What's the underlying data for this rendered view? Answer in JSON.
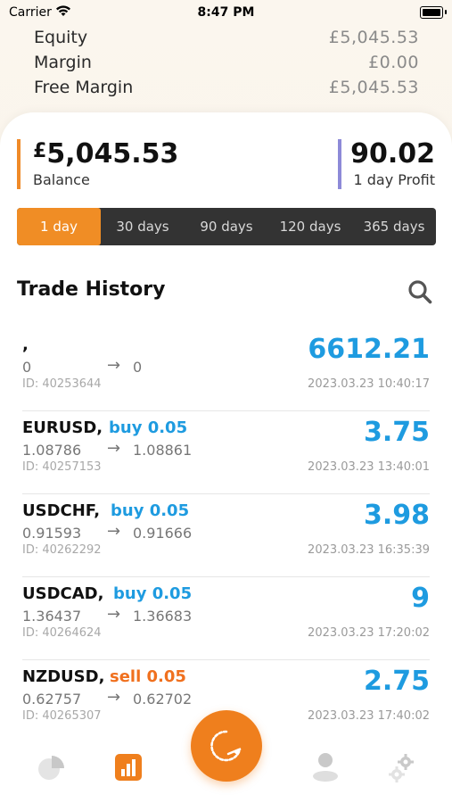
{
  "status_bar": {
    "carrier": "Carrier",
    "time": "8:47 PM"
  },
  "account": {
    "rows": [
      {
        "label": "Equity",
        "value": "£5,045.53"
      },
      {
        "label": "Margin",
        "value": "£0.00"
      },
      {
        "label": "Free Margin",
        "value": "£5,045.53"
      }
    ]
  },
  "stats": {
    "balance": {
      "currency": "£",
      "value": "5,045.53",
      "label": "Balance"
    },
    "profit": {
      "value": "90.02",
      "label": "1 day Profit"
    }
  },
  "range_tabs": [
    "1 day",
    "30 days",
    "90 days",
    "120 days",
    "365 days"
  ],
  "active_range": "1 day",
  "history": {
    "title": "Trade History",
    "trades": [
      {
        "symbol": ",",
        "side": "",
        "side_type": "",
        "open": "0",
        "arrow": "→",
        "close": "0",
        "id": "ID: 40253644",
        "profit": "6612.21",
        "time": "2023.03.23 10:40:17"
      },
      {
        "symbol": "EURUSD,",
        "side": "buy 0.05",
        "side_type": "buy",
        "open": "1.08786",
        "arrow": "→",
        "close": "1.08861",
        "id": "ID: 40257153",
        "profit": "3.75",
        "time": "2023.03.23 13:40:01"
      },
      {
        "symbol": "USDCHF,",
        "side": "buy 0.05",
        "side_type": "buy",
        "open": "0.91593",
        "arrow": "→",
        "close": "0.91666",
        "id": "ID: 40262292",
        "profit": "3.98",
        "time": "2023.03.23 16:35:39"
      },
      {
        "symbol": "USDCAD,",
        "side": "buy 0.05",
        "side_type": "buy",
        "open": "1.36437",
        "arrow": "→",
        "close": "1.36683",
        "id": "ID: 40264624",
        "profit": "9",
        "time": "2023.03.23 17:20:02"
      },
      {
        "symbol": "NZDUSD,",
        "side": "sell 0.05",
        "side_type": "sell",
        "open": "0.62757",
        "arrow": "→",
        "close": "0.62702",
        "id": "ID: 40265307",
        "profit": "2.75",
        "time": "2023.03.23 17:40:02"
      }
    ]
  },
  "nav": {
    "items": [
      "pie-chart-icon",
      "bar-chart-icon",
      "refresh-icon",
      "user-icon",
      "settings-icon"
    ]
  },
  "colors": {
    "accent": "#f08d25",
    "buy": "#1e9be0",
    "sell": "#f0701e",
    "profit_bar": "#8d8ad8"
  }
}
